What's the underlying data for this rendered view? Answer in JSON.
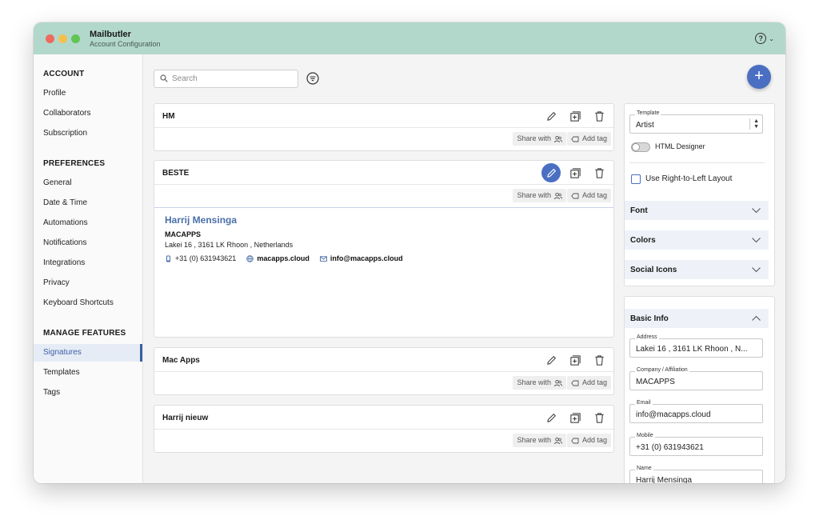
{
  "window": {
    "title": "Mailbutler",
    "subtitle": "Account Configuration"
  },
  "help": {
    "icon": "question-circle-icon",
    "glyph": "?"
  },
  "sidebar": {
    "sections": [
      {
        "heading": "ACCOUNT",
        "items": [
          "Profile",
          "Collaborators",
          "Subscription"
        ]
      },
      {
        "heading": "PREFERENCES",
        "items": [
          "General",
          "Date & Time",
          "Automations",
          "Notifications",
          "Integrations",
          "Privacy",
          "Keyboard Shortcuts"
        ]
      },
      {
        "heading": "MANAGE FEATURES",
        "items": [
          "Signatures",
          "Templates",
          "Tags"
        ]
      }
    ],
    "active_item": "Signatures"
  },
  "toolbar": {
    "search_placeholder": "Search",
    "search_value": "",
    "add_glyph": "+"
  },
  "cards": {
    "share_label": "Share with",
    "tag_label": "Add tag",
    "items": [
      {
        "title": "HM"
      },
      {
        "title": "BESTE",
        "editing": true
      },
      {
        "title": "Mac Apps"
      },
      {
        "title": "Harrij nieuw"
      }
    ]
  },
  "signature_preview": {
    "name": "Harrij Mensinga",
    "company": "MACAPPS",
    "address": "Lakei 16 , 3161 LK Rhoon , Netherlands",
    "phone": "+31 (0) 631943621",
    "website": "macapps.cloud",
    "email": "info@macapps.cloud"
  },
  "design_panel": {
    "template_label": "Template",
    "template_value": "Artist",
    "html_designer_label": "HTML Designer",
    "html_designer_on": false,
    "rtl_label": "Use Right-to-Left Layout",
    "rtl_checked": false,
    "sections": [
      "Font",
      "Colors",
      "Social Icons"
    ]
  },
  "basic_info": {
    "heading": "Basic Info",
    "fields": [
      {
        "label": "Address",
        "value": "Lakei 16 , 3161 LK Rhoon , N..."
      },
      {
        "label": "Company / Affiliation",
        "value": "MACAPPS"
      },
      {
        "label": "Email",
        "value": "info@macapps.cloud"
      },
      {
        "label": "Mobile",
        "value": "+31 (0) 631943621"
      },
      {
        "label": "Name",
        "value": "Harrij Mensinga"
      }
    ]
  },
  "colors": {
    "accent": "#4a6fc2",
    "titlebar": "#b2d8cb",
    "link": "#4a6fa8"
  }
}
